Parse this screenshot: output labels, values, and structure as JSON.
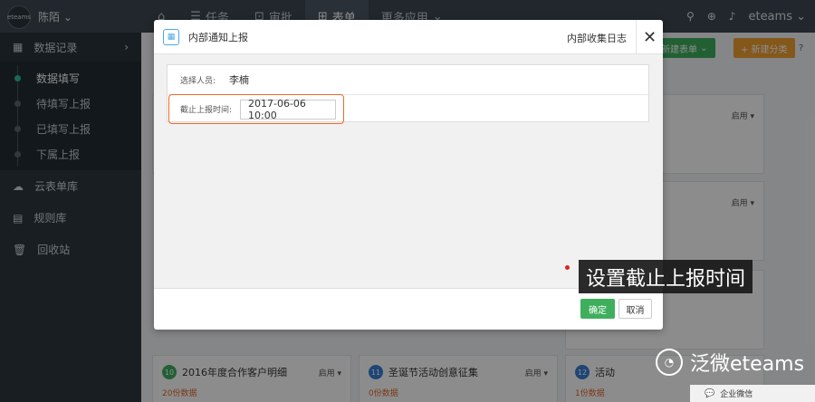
{
  "topbar": {
    "logo_text": "eteams",
    "user_name": "陈陌",
    "nav": [
      {
        "icon": "home-icon",
        "label": ""
      },
      {
        "icon": "task-icon",
        "label": "任务"
      },
      {
        "icon": "approval-icon",
        "label": "审批"
      },
      {
        "icon": "form-icon",
        "label": "表单"
      },
      {
        "icon": "apps-icon",
        "label": "更多应用"
      }
    ],
    "brand": "eteams"
  },
  "sidebar": {
    "section_label": "数据记录",
    "subitems": [
      "数据填写",
      "待填写上报",
      "已填写上报",
      "下属上报"
    ],
    "items": [
      {
        "icon": "cloud-icon",
        "label": "云表单库"
      },
      {
        "icon": "rules-icon",
        "label": "规则库"
      },
      {
        "icon": "trash-icon",
        "label": "回收站"
      }
    ]
  },
  "main": {
    "new_form_button": "新建表单",
    "new_category_button": "+ 新建分类",
    "enable_label": "启用",
    "bottom_cards": [
      {
        "num": "10",
        "title": "2016年度合作客户明细",
        "count": "20份数据"
      },
      {
        "num": "11",
        "title": "圣诞节活动创意征集",
        "count": "0份数据"
      },
      {
        "num": "12",
        "title": "活动",
        "count": "1份数据"
      }
    ]
  },
  "modal": {
    "title": "内部通知上报",
    "subtitle": "内部收集日志",
    "rows": [
      {
        "label": "选择人员:",
        "value": "李楠"
      },
      {
        "label": "截止上报时间:",
        "value": "2017-06-06 10:00"
      }
    ],
    "ok_label": "确定",
    "cancel_label": "取消"
  },
  "annotation": {
    "caption": "设置截止上报时间"
  },
  "watermark": {
    "text": "泛微eteams",
    "wechat_label": "企业微信"
  },
  "colors": {
    "accent": "#f06a2b",
    "ok": "#3faf5e",
    "topbar": "#3d4751",
    "sidebar": "#2e3841"
  }
}
